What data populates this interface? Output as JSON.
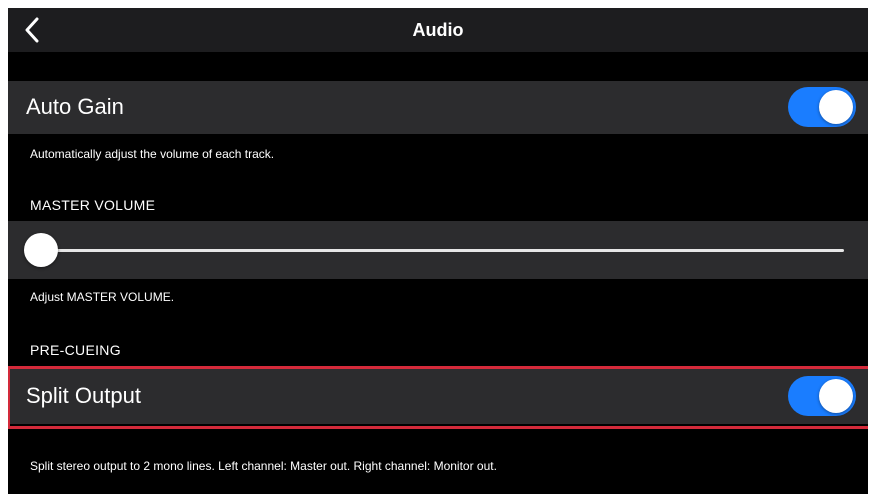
{
  "nav": {
    "title": "Audio",
    "back_icon": "chevron-left-icon"
  },
  "auto_gain": {
    "label": "Auto Gain",
    "enabled": true,
    "caption": "Automatically adjust the volume of each track."
  },
  "master_volume": {
    "header": "MASTER VOLUME",
    "value": 0,
    "caption": "Adjust MASTER VOLUME."
  },
  "pre_cueing": {
    "header": "PRE-CUEING"
  },
  "split_output": {
    "label": "Split Output",
    "enabled": true,
    "caption": "Split stereo output to 2 mono lines. Left channel: Master out. Right channel: Monitor out.",
    "highlighted": true
  },
  "colors": {
    "accent": "#1a7dff",
    "row_background": "#2c2c2e",
    "screen_background": "#000000",
    "highlight_outline": "#d32a3a"
  }
}
